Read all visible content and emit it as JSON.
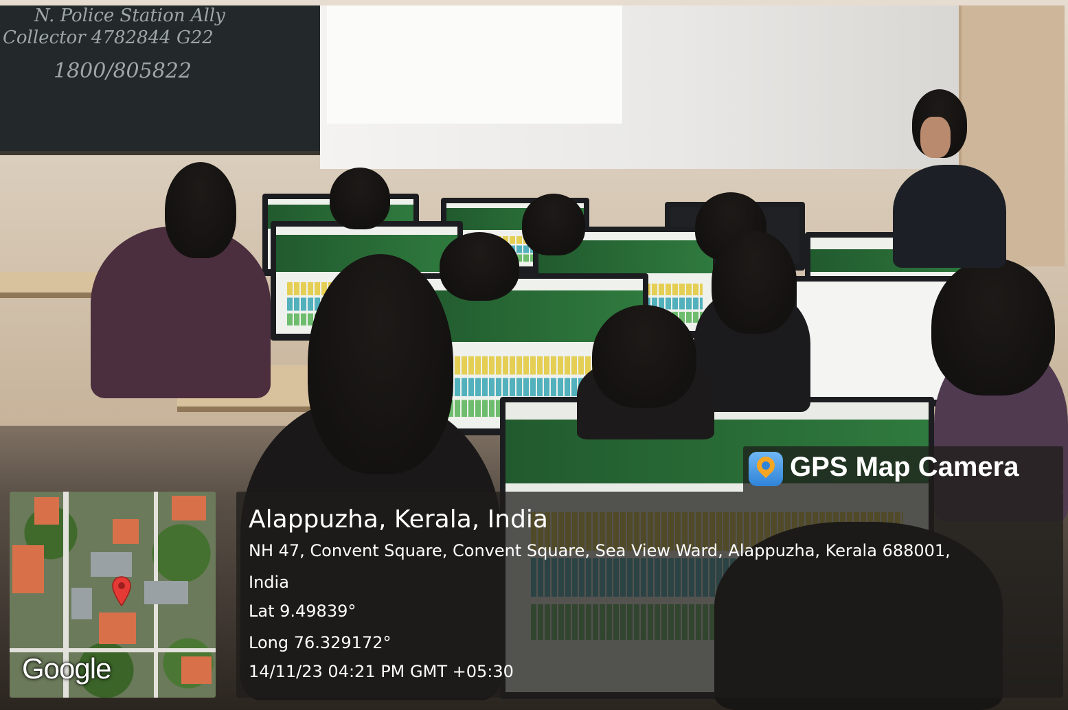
{
  "photo": {
    "blackboard_lines": [
      "N. Police Station Ally",
      "Collector 4782844 G22",
      "1800/805822"
    ]
  },
  "badge": {
    "app_name": "GPS Map Camera",
    "icon": "map-pin-camera-icon"
  },
  "map": {
    "provider_logo": "Google",
    "pin_icon": "map-pin-icon",
    "pin_color": "#e53935"
  },
  "location": {
    "place": "Alappuzha, Kerala, India",
    "address_line1": "NH 47, Convent Square, Convent Square, Sea View Ward, Alappuzha, Kerala 688001,",
    "address_line2": "India",
    "latitude": "Lat 9.49839°",
    "longitude": "Long 76.329172°",
    "datetime": "14/11/23 04:21 PM GMT +05:30"
  }
}
